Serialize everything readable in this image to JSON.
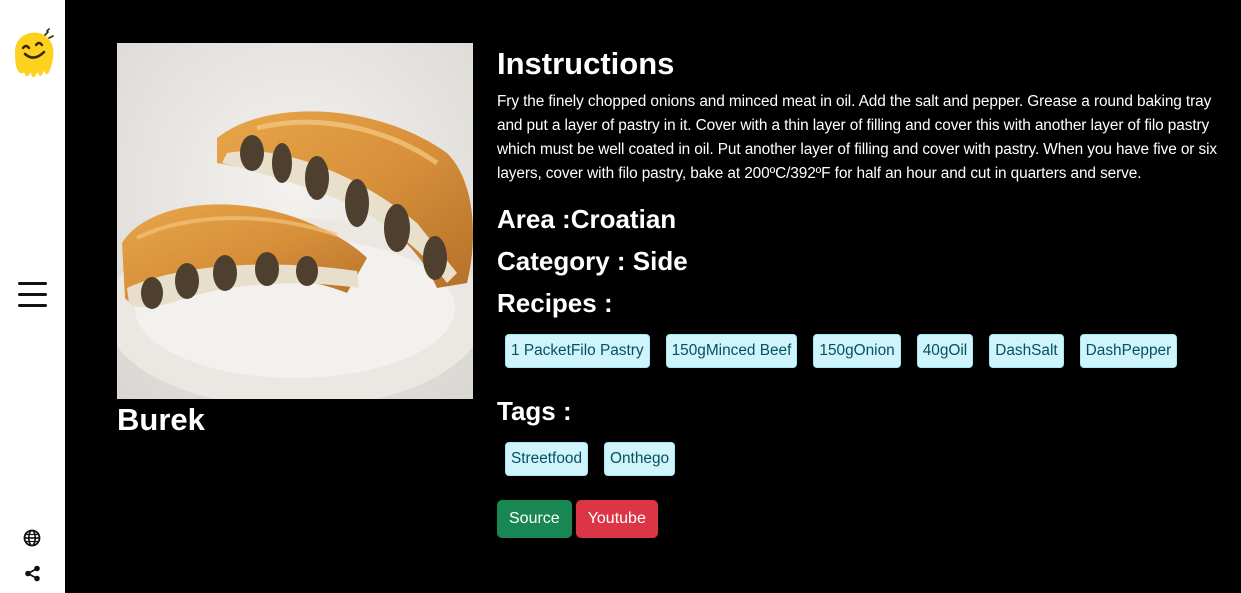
{
  "sidebar": {
    "logo_icon": "smiley-melting-logo",
    "menu_icon": "hamburger-menu-icon",
    "language_icon": "globe-icon",
    "share_icon": "share-icon"
  },
  "meal": {
    "name": "Burek",
    "image_alt": "Burek"
  },
  "instructions": {
    "heading": "Instructions",
    "text": "Fry the finely chopped onions and minced meat in oil. Add the salt and pepper. Grease a round baking tray and put a layer of pastry in it. Cover with a thin layer of filling and cover this with another layer of filo pastry which must be well coated in oil. Put another layer of filling and cover with pastry. When you have five or six layers, cover with filo pastry, bake at 200ºC/392ºF for half an hour and cut in quarters and serve."
  },
  "area_line": "Area :Croatian",
  "category_line": "Category : Side",
  "recipes": {
    "heading": "Recipes :",
    "items": [
      "1 PacketFilo Pastry",
      "150gMinced Beef",
      "150gOnion",
      "40gOil",
      "DashSalt",
      "DashPepper"
    ]
  },
  "tags": {
    "heading": "Tags :",
    "items": [
      "Streetfood",
      "Onthego"
    ]
  },
  "buttons": {
    "source": "Source",
    "youtube": "Youtube"
  },
  "colors": {
    "chip_bg": "#cff4fc",
    "chip_text": "#055160",
    "source_button": "#198754",
    "youtube_button": "#dc3545"
  }
}
